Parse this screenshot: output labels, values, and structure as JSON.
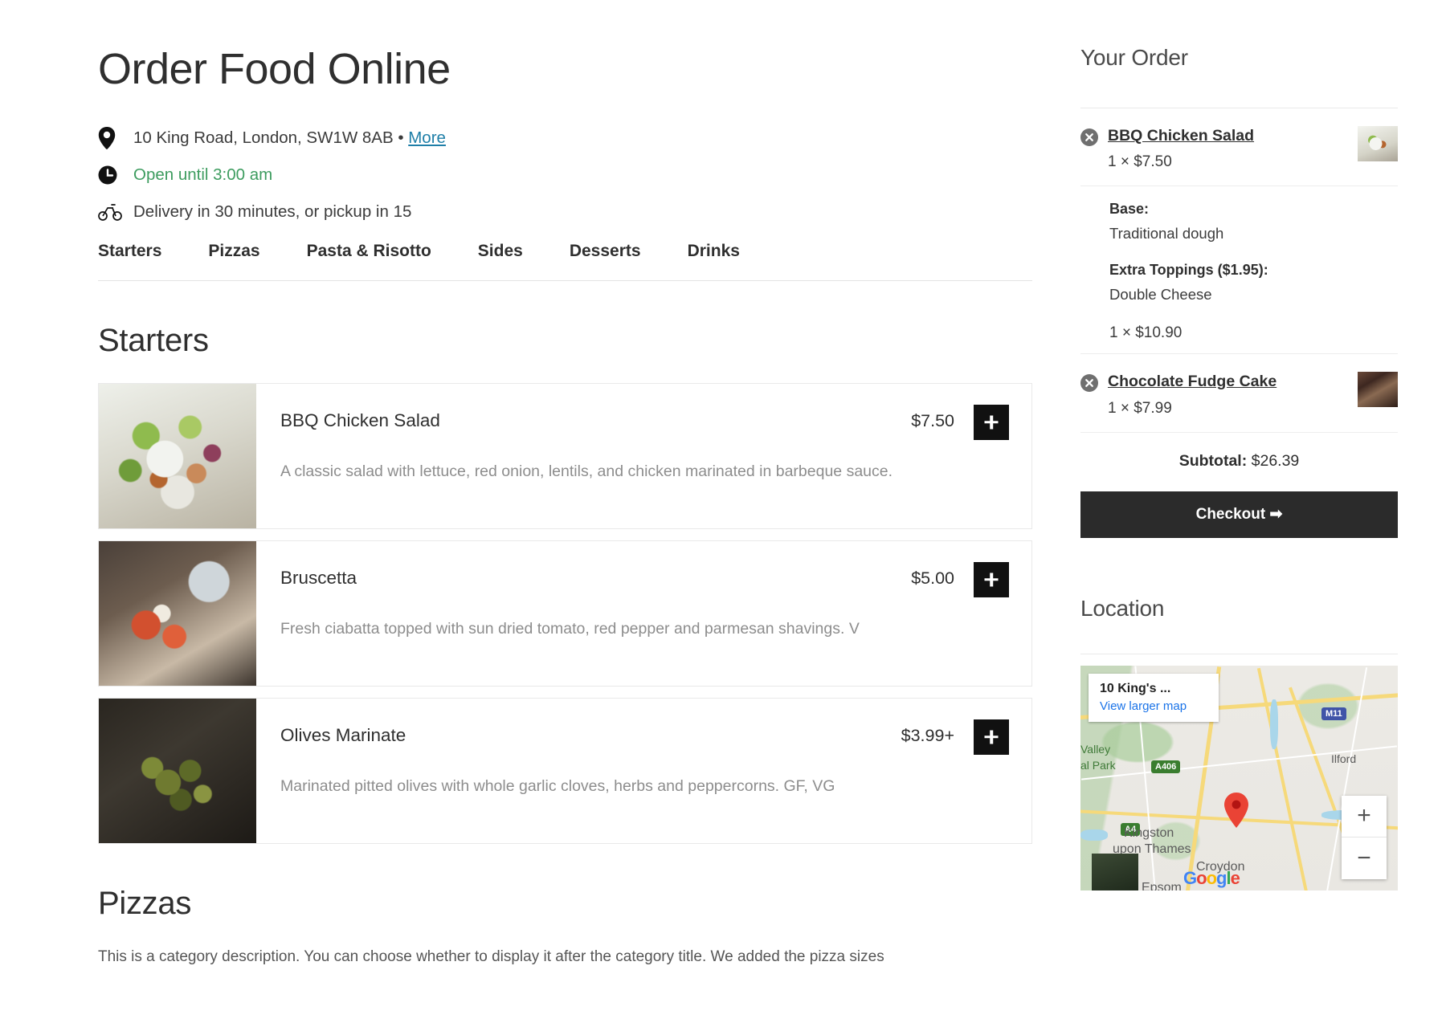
{
  "header": {
    "title": "Order Food Online",
    "address": "10 King Road, London, SW1W 8AB",
    "address_separator": "•",
    "more_link": "More",
    "hours": "Open until 3:00 am",
    "delivery": "Delivery in 30 minutes, or pickup in 15",
    "location_icon": "map-pin-icon",
    "clock_icon": "clock-icon",
    "bike_icon": "bicycle-icon",
    "hours_color": "#3d9c5f",
    "link_color": "#1f7fa8"
  },
  "nav": {
    "tabs": [
      {
        "label": "Starters"
      },
      {
        "label": "Pizzas"
      },
      {
        "label": "Pasta & Risotto"
      },
      {
        "label": "Sides"
      },
      {
        "label": "Desserts"
      },
      {
        "label": "Drinks"
      }
    ]
  },
  "menu": {
    "starters": {
      "section_title": "Starters",
      "items": [
        {
          "name": "BBQ Chicken Salad",
          "price": "$7.50",
          "description": "A classic salad with lettuce, red onion, lentils, and chicken marinated in barbeque sauce.",
          "add_label": "+"
        },
        {
          "name": "Bruscetta",
          "price": "$5.00",
          "description": "Fresh ciabatta topped with sun dried tomato, red pepper and parmesan shavings. V",
          "add_label": "+"
        },
        {
          "name": "Olives Marinate",
          "price": "$3.99+",
          "description": "Marinated pitted olives with whole garlic cloves, herbs and peppercorns. GF, VG",
          "add_label": "+"
        }
      ]
    },
    "pizzas": {
      "section_title": "Pizzas",
      "description": "This is a category description. You can choose whether to display it after the category title. We added the pizza sizes"
    }
  },
  "sidebar": {
    "order_title": "Your Order",
    "items": [
      {
        "name": "BBQ Chicken Salad",
        "qty_price": "1 × $7.50",
        "remove_icon": "remove-circle-icon",
        "thumb": "salad-thumbnail"
      },
      {
        "name": "Chocolate Fudge Cake",
        "qty_price": "1 × $7.99",
        "remove_icon": "remove-circle-icon",
        "thumb": "cake-thumbnail"
      }
    ],
    "options": {
      "base_label": "Base:",
      "base_value": "Traditional dough",
      "toppings_label": "Extra Toppings ($1.95):",
      "toppings_value": "Double Cheese",
      "option_qty_price": "1 × $10.90"
    },
    "subtotal_label": "Subtotal:",
    "subtotal_value": "$26.39",
    "checkout_label": "Checkout",
    "checkout_arrow": "➡",
    "checkout_color": "#2b2b2b"
  },
  "location": {
    "title": "Location",
    "map": {
      "card_title": "10 King's ...",
      "view_larger": "View larger map",
      "zoom_in": "+",
      "zoom_out": "−",
      "labels": [
        {
          "text": "M11"
        },
        {
          "text": "A406"
        },
        {
          "text": "A4"
        },
        {
          "text": "Ilford"
        },
        {
          "text": "Valley"
        },
        {
          "text": "al Park"
        },
        {
          "text": "Kingston"
        },
        {
          "text": "upon Thames"
        },
        {
          "text": "Croydon"
        },
        {
          "text": "Epsom"
        }
      ],
      "brand": "Google",
      "pin_color": "#ea4335",
      "link_color": "#1a73e8"
    }
  }
}
